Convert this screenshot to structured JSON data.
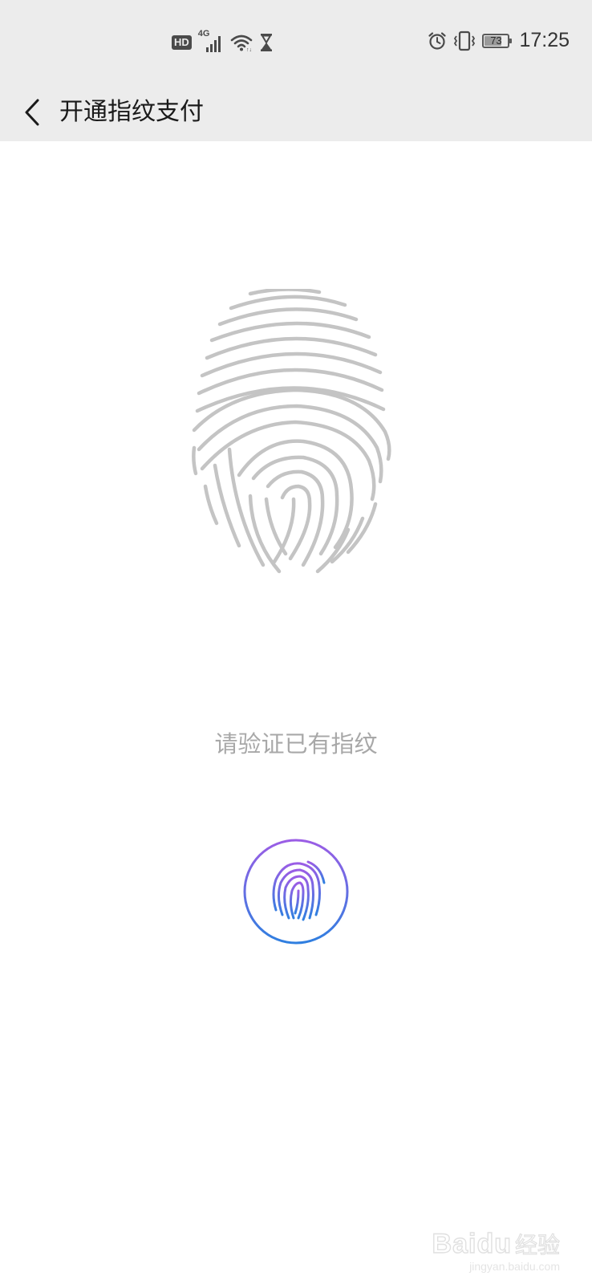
{
  "status_bar": {
    "hd_label": "HD",
    "network_label": "4G",
    "battery_percent": "73",
    "time": "17:25",
    "icons": [
      "hd-icon",
      "signal-4g-icon",
      "wifi-icon",
      "hourglass-icon",
      "alarm-icon",
      "vibrate-icon",
      "battery-icon"
    ]
  },
  "header": {
    "back_icon": "chevron-left-icon",
    "title": "开通指纹支付"
  },
  "main": {
    "illustration_icon": "fingerprint-icon",
    "prompt": "请验证已有指纹",
    "button_icon": "fingerprint-icon",
    "button_gradient": [
      "#9b5de5",
      "#2f7fe0"
    ]
  },
  "watermark": {
    "logo": "Baidu",
    "label": "经验",
    "url": "jingyan.baidu.com"
  },
  "colors": {
    "bar_background": "#ececec",
    "fingerprint_gray": "#c4c4c4",
    "prompt_gray": "#a8a8a8"
  }
}
